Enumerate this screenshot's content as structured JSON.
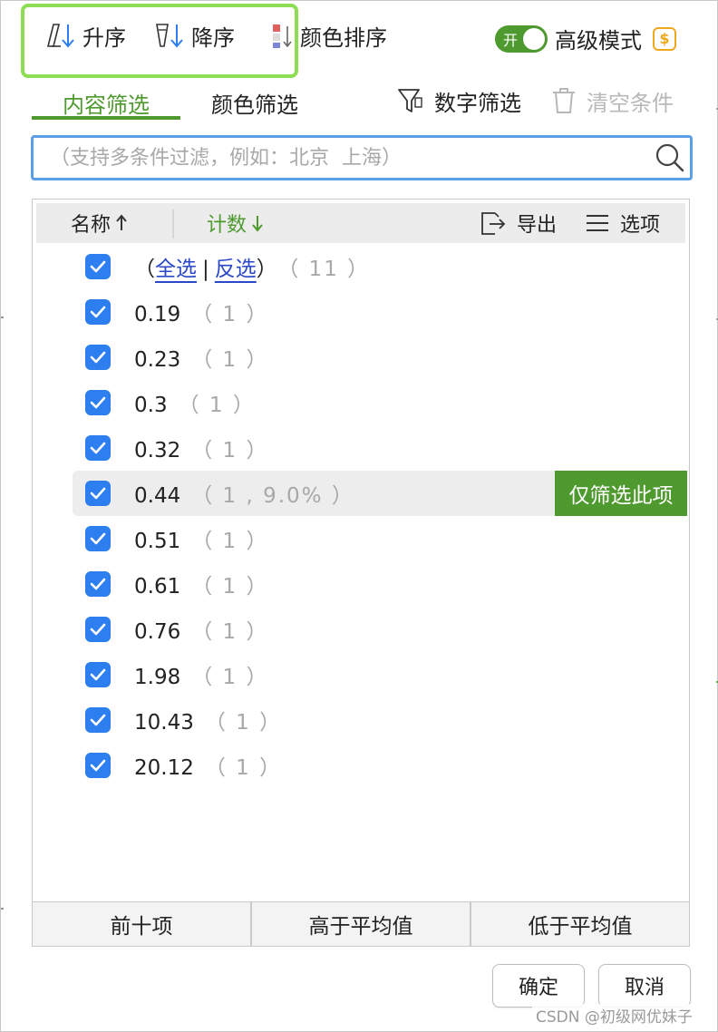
{
  "toolbar": {
    "sort_asc": "升序",
    "sort_desc": "降序",
    "color_sort": "颜色排序",
    "toggle_label": "开",
    "advanced_mode": "高级模式"
  },
  "tabs": {
    "content_filter": "内容筛选",
    "color_filter": "颜色筛选",
    "number_filter": "数字筛选",
    "clear_conditions": "清空条件"
  },
  "search": {
    "placeholder": "（支持多条件过滤，例如：北京  上海）",
    "value": ""
  },
  "list_header": {
    "name": "名称",
    "count": "计数",
    "export": "导出",
    "options": "选项"
  },
  "select_row": {
    "open_paren": "（",
    "select_all": "全选",
    "divider": "|",
    "invert": "反选",
    "close_paren": "）",
    "total": "（ 11 ）",
    "checked": true
  },
  "items": [
    {
      "value": "0.19",
      "count": "（ 1 ）",
      "checked": true
    },
    {
      "value": "0.23",
      "count": "（ 1 ）",
      "checked": true
    },
    {
      "value": "0.3",
      "count": "（ 1 ）",
      "checked": true
    },
    {
      "value": "0.32",
      "count": "（ 1 ）",
      "checked": true
    },
    {
      "value": "0.44",
      "count": "（ 1 , 9.0% ）",
      "checked": true
    },
    {
      "value": "0.51",
      "count": "（ 1 ）",
      "checked": true
    },
    {
      "value": "0.61",
      "count": "（ 1 ）",
      "checked": true
    },
    {
      "value": "0.76",
      "count": "（ 1 ）",
      "checked": true
    },
    {
      "value": "1.98",
      "count": "（ 1 ）",
      "checked": true
    },
    {
      "value": "10.43",
      "count": "（ 1 ）",
      "checked": true
    },
    {
      "value": "20.12",
      "count": "（ 1 ）",
      "checked": true
    }
  ],
  "hover_action": "仅筛选此项",
  "quick_filters": {
    "top_ten": "前十项",
    "above_avg": "高于平均值",
    "below_avg": "低于平均值"
  },
  "footer": {
    "ok": "确定",
    "cancel": "取消"
  },
  "watermark": "CSDN @初级网优妹子",
  "colors": {
    "accent_green": "#4e9a2f",
    "highlight_box": "#8ede55",
    "checkbox_blue": "#2d7ff0",
    "link_blue": "#2a48c8",
    "search_border": "#5b9ee6"
  }
}
